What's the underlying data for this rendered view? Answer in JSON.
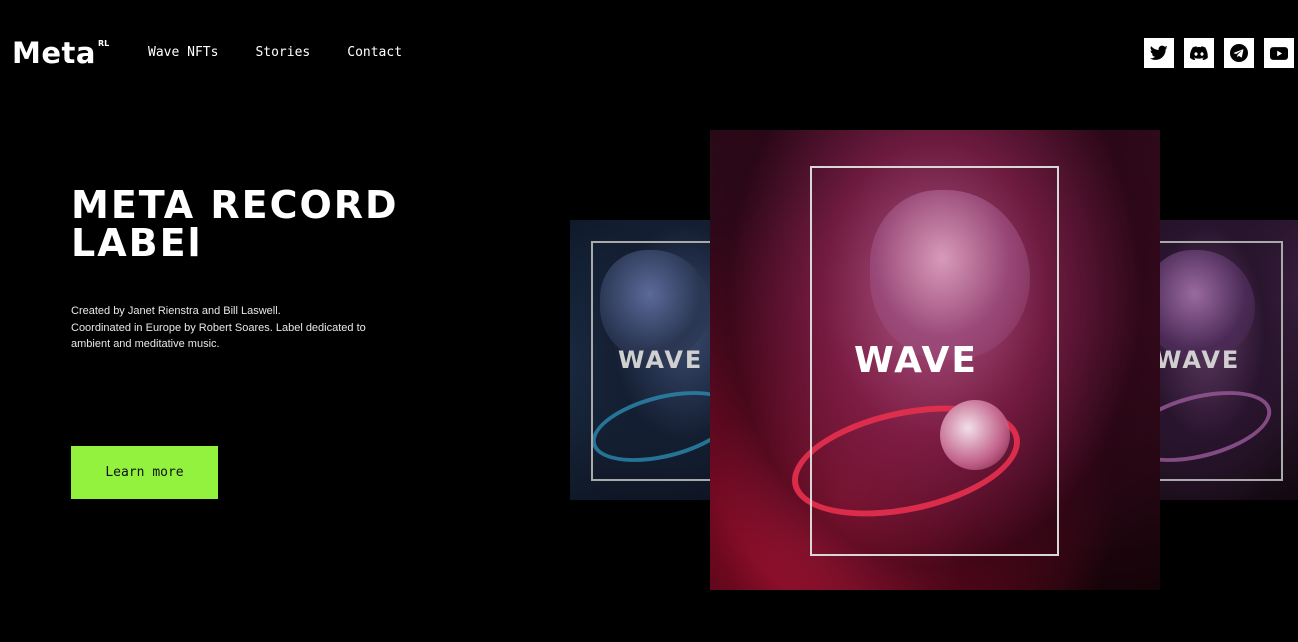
{
  "brand": {
    "name": "Meta",
    "superscript": "RL"
  },
  "nav": {
    "items": [
      {
        "label": "Wave NFTs"
      },
      {
        "label": "Stories"
      },
      {
        "label": "Contact"
      }
    ]
  },
  "social": {
    "icons": [
      "twitter-icon",
      "discord-icon",
      "telegram-icon",
      "youtube-icon"
    ]
  },
  "hero": {
    "title_line1": "META RECORD",
    "title_line2": "LABEl",
    "description_line1": "Created by Janet Rienstra and Bill Laswell.",
    "description_line2": "Coordinated in Europe by Robert Soares. Label dedicated to ambient and meditative music.",
    "cta_label": "Learn more"
  },
  "gallery": {
    "cards": [
      {
        "title": "WAVE"
      },
      {
        "title": "WAVE"
      },
      {
        "title": "WAVE"
      }
    ]
  },
  "colors": {
    "background": "#000000",
    "accent": "#93f23d",
    "text": "#ffffff"
  }
}
